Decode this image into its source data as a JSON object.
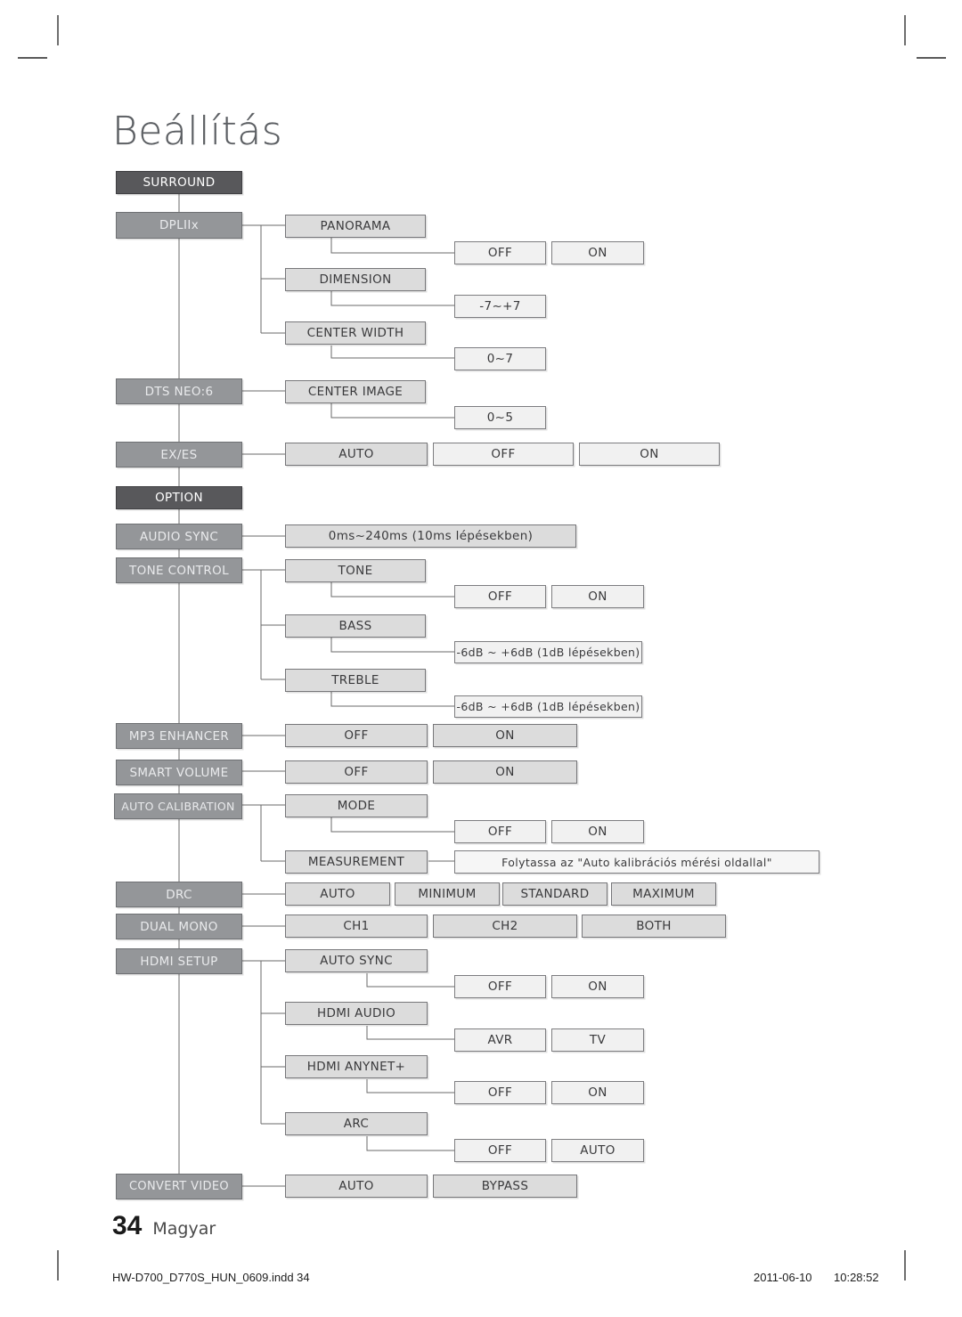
{
  "page": {
    "title": "Beállítás",
    "folio_number": "34",
    "folio_language": "Magyar",
    "footer_filename": "HW-D700_D770S_HUN_0609.indd   34",
    "footer_date": "2011-06-10",
    "footer_time": "10:28:52"
  },
  "colors": {
    "level0_bg": "#58585b",
    "level1_bg": "#949699",
    "level2_bg": "#dcdcdc",
    "level3_bg": "#f1f1f1",
    "title_text": "#5c5f63",
    "wire": "#6a6a6a"
  },
  "diagram": {
    "type": "menu-tree",
    "sections": [
      {
        "id": "surround",
        "header": "SURROUND",
        "items": [
          {
            "label": "DPLIIx",
            "children": [
              {
                "label": "PANORAMA",
                "values": [
                  "OFF",
                  "ON"
                ]
              },
              {
                "label": "DIMENSION",
                "values": [
                  "-7~+7"
                ]
              },
              {
                "label": "CENTER WIDTH",
                "values": [
                  "0~7"
                ]
              }
            ]
          },
          {
            "label": "DTS NEO:6",
            "children": [
              {
                "label": "CENTER IMAGE",
                "values": [
                  "0~5"
                ]
              }
            ]
          },
          {
            "label": "EX/ES",
            "values": [
              "AUTO",
              "OFF",
              "ON"
            ]
          }
        ]
      },
      {
        "id": "option",
        "header": "OPTION",
        "items": [
          {
            "label": "AUDIO SYNC",
            "values": [
              "0ms~240ms (10ms lépésekben)"
            ]
          },
          {
            "label": "TONE CONTROL",
            "children": [
              {
                "label": "TONE",
                "values": [
                  "OFF",
                  "ON"
                ]
              },
              {
                "label": "BASS",
                "values": [
                  "-6dB ~ +6dB (1dB lépésekben)"
                ]
              },
              {
                "label": "TREBLE",
                "values": [
                  "-6dB ~ +6dB (1dB lépésekben)"
                ]
              }
            ]
          },
          {
            "label": "MP3 ENHANCER",
            "values": [
              "OFF",
              "ON"
            ]
          },
          {
            "label": "SMART VOLUME",
            "values": [
              "OFF",
              "ON"
            ]
          },
          {
            "label": "AUTO CALIBRATION",
            "children": [
              {
                "label": "MODE",
                "values": [
                  "OFF",
                  "ON"
                ]
              },
              {
                "label": "MEASUREMENT",
                "values": [
                  "Folytassa az \"Auto kalibrációs mérési oldallal\""
                ]
              }
            ]
          },
          {
            "label": "DRC",
            "values": [
              "AUTO",
              "MINIMUM",
              "STANDARD",
              "MAXIMUM"
            ]
          },
          {
            "label": "DUAL MONO",
            "values": [
              "CH1",
              "CH2",
              "BOTH"
            ]
          },
          {
            "label": "HDMI SETUP",
            "children": [
              {
                "label": "AUTO SYNC",
                "values": [
                  "OFF",
                  "ON"
                ]
              },
              {
                "label": "HDMI AUDIO",
                "values": [
                  "AVR",
                  "TV"
                ]
              },
              {
                "label": "HDMI ANYNET+",
                "values": [
                  "OFF",
                  "ON"
                ]
              },
              {
                "label": "ARC",
                "values": [
                  "OFF",
                  "AUTO"
                ]
              }
            ]
          },
          {
            "label": "CONVERT VIDEO",
            "values": [
              "AUTO",
              "BYPASS"
            ]
          }
        ]
      }
    ],
    "flat_nodes": {
      "surround": "SURROUND",
      "dpliix": "DPLIIx",
      "panorama": "PANORAMA",
      "panorama_off": "OFF",
      "panorama_on": "ON",
      "dimension": "DIMENSION",
      "dimension_range": "-7~+7",
      "center_width": "CENTER WIDTH",
      "center_width_range": "0~7",
      "dts_neo6": "DTS NEO:6",
      "center_image": "CENTER IMAGE",
      "center_image_range": "0~5",
      "exes": "EX/ES",
      "exes_auto": "AUTO",
      "exes_off": "OFF",
      "exes_on": "ON",
      "option": "OPTION",
      "audio_sync": "AUDIO SYNC",
      "audio_sync_range": "0ms~240ms (10ms lépésekben)",
      "tone_control": "TONE CONTROL",
      "tone": "TONE",
      "tone_off": "OFF",
      "tone_on": "ON",
      "bass": "BASS",
      "bass_range": "-6dB ~ +6dB (1dB lépésekben)",
      "treble": "TREBLE",
      "treble_range": "-6dB ~ +6dB (1dB lépésekben)",
      "mp3_enhancer": "MP3 ENHANCER",
      "mp3_off": "OFF",
      "mp3_on": "ON",
      "smart_volume": "SMART VOLUME",
      "smart_off": "OFF",
      "smart_on": "ON",
      "auto_calibration": "AUTO CALIBRATION",
      "mode": "MODE",
      "mode_off": "OFF",
      "mode_on": "ON",
      "measurement": "MEASUREMENT",
      "measurement_note": "Folytassa az \"Auto kalibrációs mérési oldallal\"",
      "drc": "DRC",
      "drc_auto": "AUTO",
      "drc_minimum": "MINIMUM",
      "drc_standard": "STANDARD",
      "drc_maximum": "MAXIMUM",
      "dual_mono": "DUAL MONO",
      "dual_ch1": "CH1",
      "dual_ch2": "CH2",
      "dual_both": "BOTH",
      "hdmi_setup": "HDMI SETUP",
      "hdmi_auto_sync": "AUTO SYNC",
      "hdmi_auto_sync_off": "OFF",
      "hdmi_auto_sync_on": "ON",
      "hdmi_audio": "HDMI AUDIO",
      "hdmi_audio_avr": "AVR",
      "hdmi_audio_tv": "TV",
      "hdmi_anynet": "HDMI ANYNET+",
      "hdmi_anynet_off": "OFF",
      "hdmi_anynet_on": "ON",
      "arc": "ARC",
      "arc_off": "OFF",
      "arc_auto": "AUTO",
      "convert_video": "CONVERT VIDEO",
      "convert_auto": "AUTO",
      "convert_bypass": "BYPASS"
    }
  }
}
